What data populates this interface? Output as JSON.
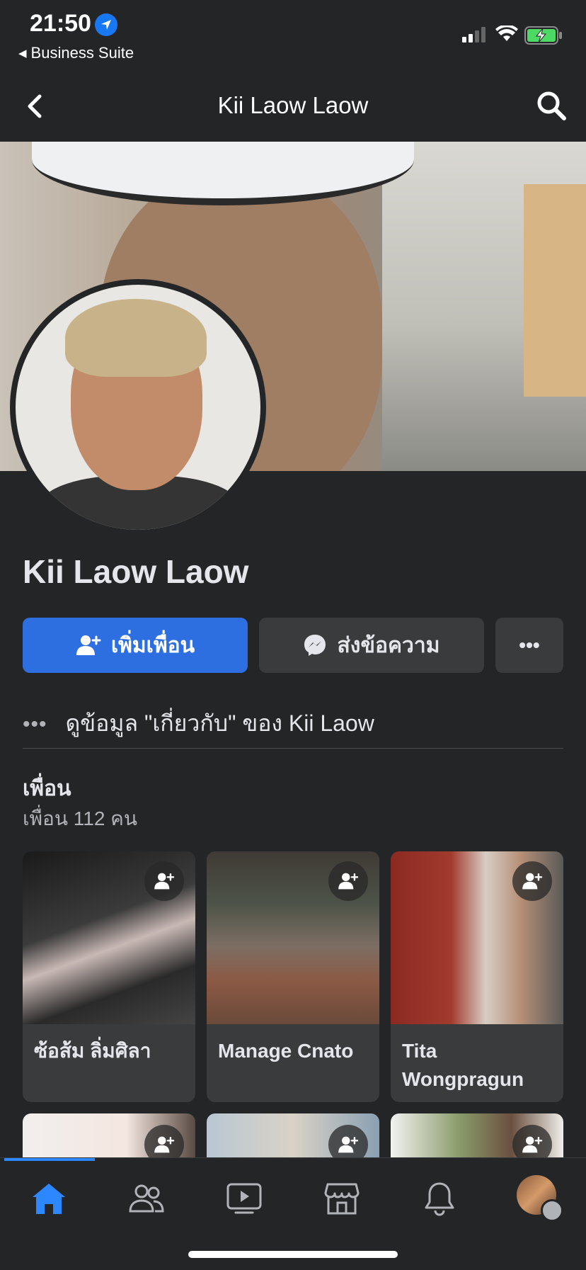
{
  "status_bar": {
    "time": "21:50",
    "back_app": "Business Suite",
    "back_arrow": "◀"
  },
  "navbar": {
    "title": "Kii Laow Laow"
  },
  "profile": {
    "name": "Kii Laow Laow",
    "add_friend_label": "เพิ่มเพื่อน",
    "message_label": "ส่งข้อความ",
    "more_label": "•••",
    "about_dots": "•••",
    "about_text": "ดูข้อมูล \"เกี่ยวกับ\" ของ Kii Laow"
  },
  "friends": {
    "title": "เพื่อน",
    "count_text": "เพื่อน 112 คน",
    "cards": [
      {
        "name": "ซ้อส้ม ลิ่มศิลา"
      },
      {
        "name": "Manage Cnato"
      },
      {
        "name": "Tita Wongpragun"
      }
    ]
  },
  "tabbar": {
    "active_tab": "home",
    "tabs": [
      "home-icon",
      "friends-icon",
      "watch-icon",
      "marketplace-icon",
      "notifications-icon",
      "profile-menu"
    ]
  },
  "colors": {
    "background": "#242526",
    "accent": "#2d6fe0",
    "secondary_button": "#3a3b3c"
  }
}
